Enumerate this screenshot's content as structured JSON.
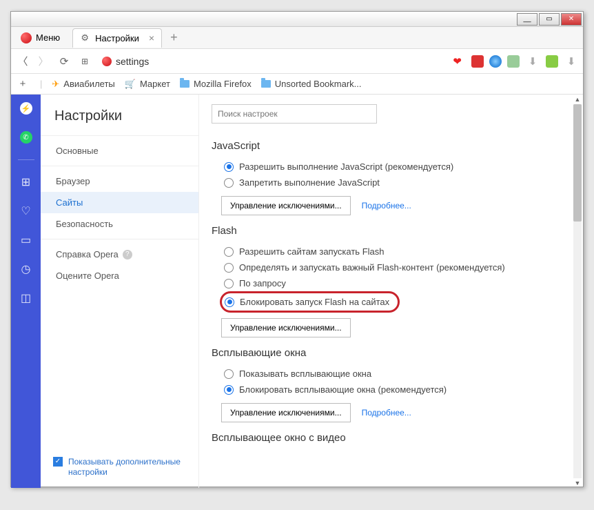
{
  "window": {
    "menu_label": "Меню"
  },
  "tabs": {
    "settings_label": "Настройки"
  },
  "address": {
    "value": "settings"
  },
  "bookmarks": {
    "items": [
      "Авиабилеты",
      "Маркет",
      "Mozilla Firefox",
      "Unsorted Bookmark..."
    ]
  },
  "sidebar": {
    "title": "Настройки",
    "items": [
      "Основные",
      "Браузер",
      "Сайты",
      "Безопасность"
    ],
    "help": "Справка Opera",
    "rate": "Оцените Opera",
    "show_advanced": "Показывать дополнительные настройки"
  },
  "content": {
    "search_placeholder": "Поиск настроек",
    "javascript": {
      "title": "JavaScript",
      "allow": "Разрешить выполнение JavaScript (рекомендуется)",
      "deny": "Запретить выполнение JavaScript",
      "manage": "Управление исключениями...",
      "more": "Подробнее..."
    },
    "flash": {
      "title": "Flash",
      "allow": "Разрешить сайтам запускать Flash",
      "detect": "Определять и запускать важный Flash-контент (рекомендуется)",
      "ondemand": "По запросу",
      "block": "Блокировать запуск Flash на сайтах",
      "manage": "Управление исключениями..."
    },
    "popups": {
      "title": "Всплывающие окна",
      "show": "Показывать всплывающие окна",
      "block": "Блокировать всплывающие окна (рекомендуется)",
      "manage": "Управление исключениями...",
      "more": "Подробнее..."
    },
    "video": {
      "title": "Всплывающее окно с видео"
    }
  }
}
